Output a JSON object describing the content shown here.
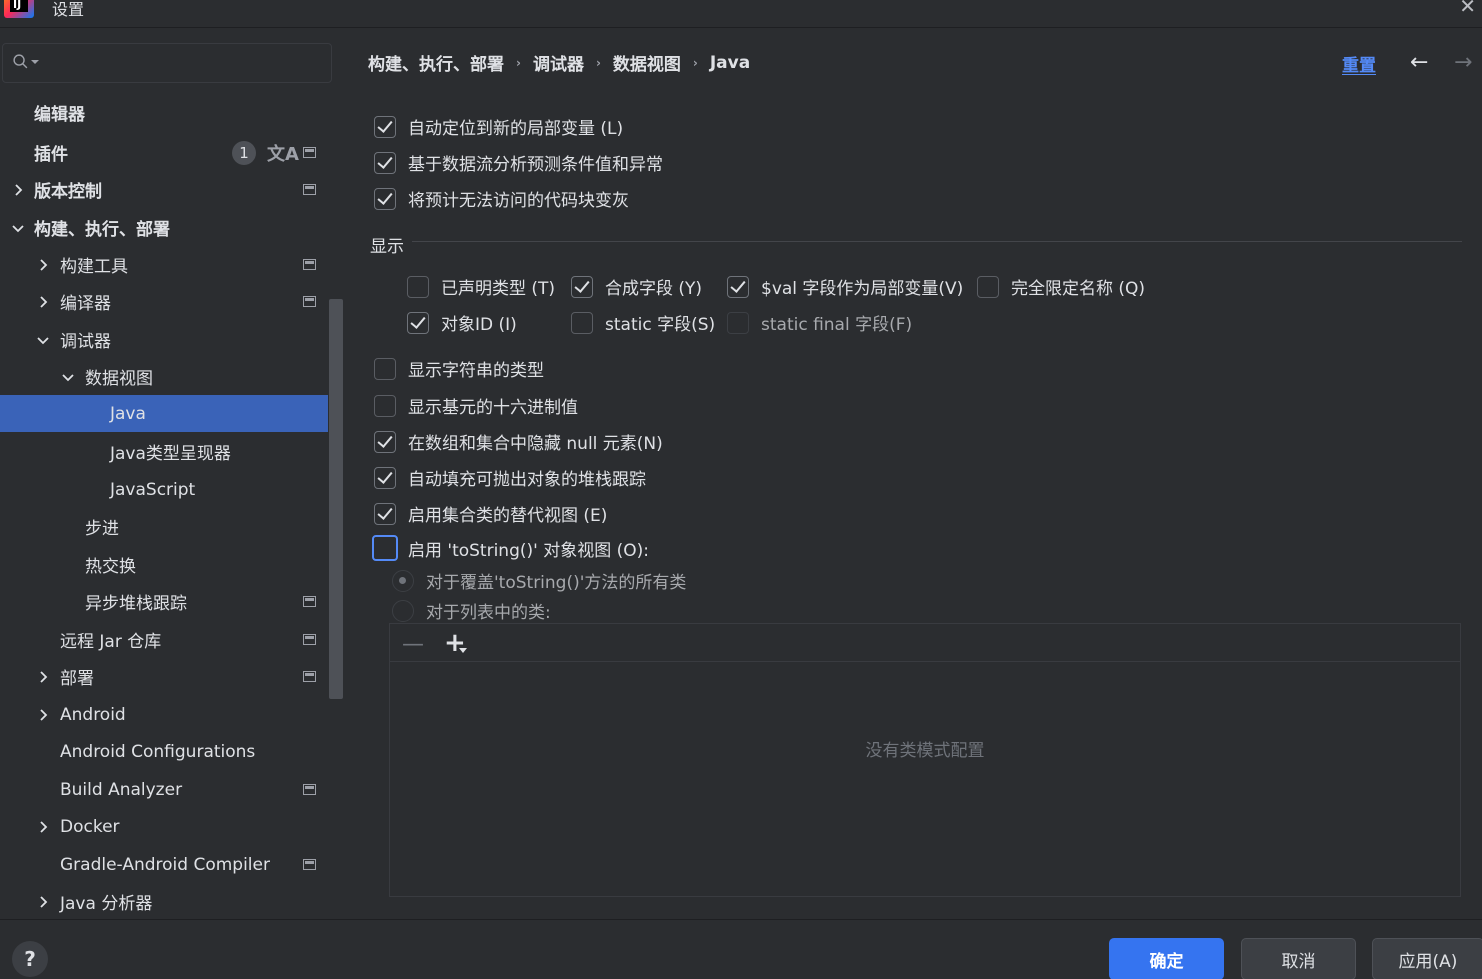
{
  "window": {
    "title": "设置",
    "logo_text": "IJ"
  },
  "sidebar": {
    "search_placeholder": "",
    "items": [
      {
        "label": "编辑器"
      },
      {
        "label": "插件",
        "badge": "1"
      },
      {
        "label": "版本控制"
      },
      {
        "label": "构建、执行、部署"
      },
      {
        "label": "构建工具"
      },
      {
        "label": "编译器"
      },
      {
        "label": "调试器"
      },
      {
        "label": "数据视图"
      },
      {
        "label": "Java"
      },
      {
        "label": "Java类型呈现器"
      },
      {
        "label": "JavaScript"
      },
      {
        "label": "步进"
      },
      {
        "label": "热交换"
      },
      {
        "label": "异步堆栈跟踪"
      },
      {
        "label": "远程 Jar 仓库"
      },
      {
        "label": "部署"
      },
      {
        "label": "Android"
      },
      {
        "label": "Android Configurations"
      },
      {
        "label": "Build Analyzer"
      },
      {
        "label": "Docker"
      },
      {
        "label": "Gradle-Android Compiler"
      },
      {
        "label": "Java 分析器"
      }
    ]
  },
  "main": {
    "breadcrumb": [
      "构建、执行、部署",
      "调试器",
      "数据视图",
      "Java"
    ],
    "reset_label": "重置",
    "options_top": [
      {
        "label": "自动定位到新的局部变量 (L)",
        "checked": true
      },
      {
        "label": "基于数据流分析预测条件值和异常",
        "checked": true
      },
      {
        "label": "将预计无法访问的代码块变灰",
        "checked": true
      }
    ],
    "display_section": {
      "title": "显示",
      "row1": [
        {
          "label": "已声明类型 (T)",
          "checked": false
        },
        {
          "label": "合成字段 (Y)",
          "checked": true
        },
        {
          "label": "$val 字段作为局部变量(V)",
          "checked": true
        },
        {
          "label": "完全限定名称 (Q)",
          "checked": false
        }
      ],
      "row2": [
        {
          "label": "对象ID (I)",
          "checked": true
        },
        {
          "label": "static 字段(S)",
          "checked": false
        },
        {
          "label": "static final 字段(F)",
          "checked": false,
          "disabled": true
        }
      ]
    },
    "options_bottom": [
      {
        "label": "显示字符串的类型",
        "checked": false
      },
      {
        "label": "显示基元的十六进制值",
        "checked": false
      },
      {
        "label": "在数组和集合中隐藏 null 元素(N)",
        "checked": true
      },
      {
        "label": "自动填充可抛出对象的堆栈跟踪",
        "checked": true
      },
      {
        "label": "启用集合类的替代视图 (E)",
        "checked": true
      },
      {
        "label": "启用 'toString()' 对象视图 (O):",
        "checked": false,
        "focused": true
      }
    ],
    "radios": [
      {
        "label": "对于覆盖'toString()'方法的所有类",
        "selected": true
      },
      {
        "label": "对于列表中的类:",
        "selected": false
      }
    ],
    "list_empty_text": "没有类模式配置"
  },
  "footer": {
    "help_label": "?",
    "ok_label": "确定",
    "cancel_label": "取消",
    "apply_label": "应用(A)"
  },
  "colors": {
    "background": "#2b2d30",
    "selection": "#3a63b8",
    "accent": "#3574f0",
    "link": "#548af7"
  }
}
